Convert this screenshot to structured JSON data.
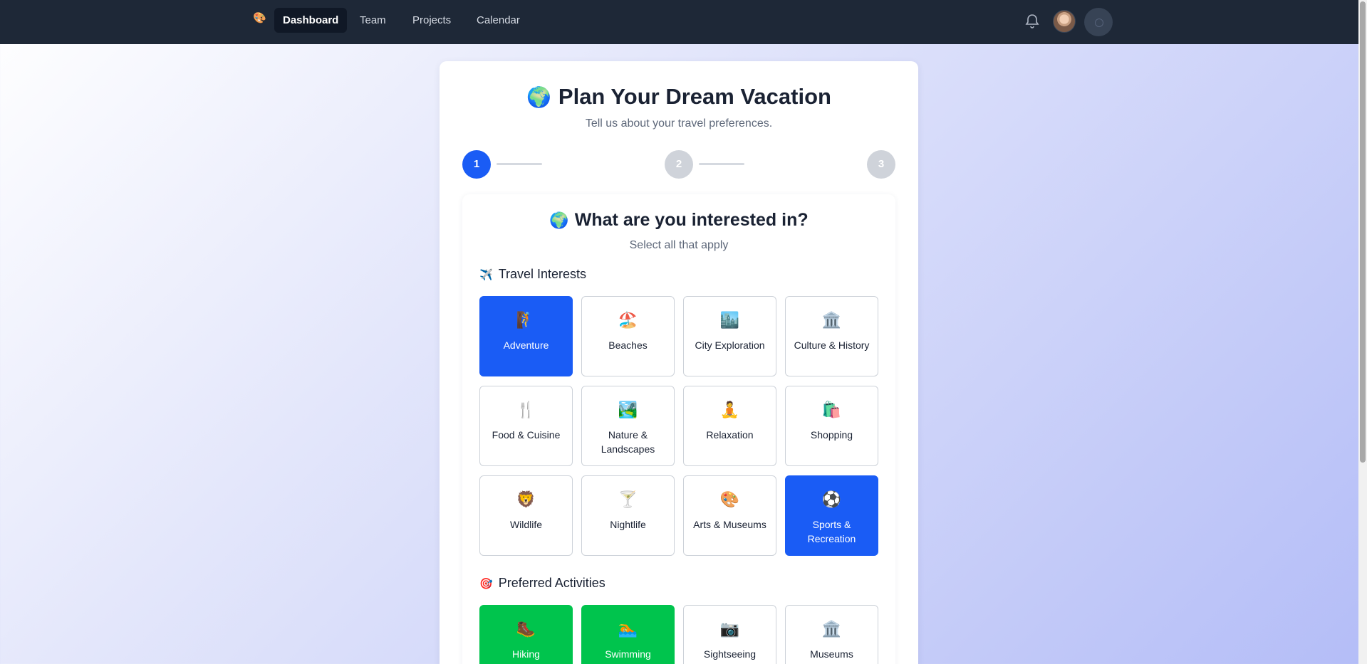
{
  "nav": {
    "logo_glyph": "🎨",
    "links": [
      {
        "label": "Dashboard",
        "active": true
      },
      {
        "label": "Team",
        "active": false
      },
      {
        "label": "Projects",
        "active": false
      },
      {
        "label": "Calendar",
        "active": false
      }
    ],
    "icons": [
      "bell-icon",
      "avatar",
      "loading-button"
    ]
  },
  "page": {
    "title_emoji": "🌍",
    "title": "Plan Your Dream Vacation",
    "subtitle": "Tell us about your travel preferences.",
    "steps": [
      "1",
      "2",
      "3"
    ],
    "active_step": 1
  },
  "question": {
    "emoji": "🌍",
    "title": "What are you interested in?",
    "subtitle": "Select all that apply"
  },
  "interests": {
    "emoji": "✈️",
    "title": "Travel Interests",
    "items": [
      {
        "icon": "🧗",
        "label": "Adventure",
        "selected": true
      },
      {
        "icon": "🏖️",
        "label": "Beaches",
        "selected": false
      },
      {
        "icon": "🏙️",
        "label": "City Exploration",
        "selected": false
      },
      {
        "icon": "🏛️",
        "label": "Culture & History",
        "selected": false
      },
      {
        "icon": "🍴",
        "label": "Food & Cuisine",
        "selected": false
      },
      {
        "icon": "🏞️",
        "label": "Nature & Landscapes",
        "selected": false
      },
      {
        "icon": "🧘",
        "label": "Relaxation",
        "selected": false
      },
      {
        "icon": "🛍️",
        "label": "Shopping",
        "selected": false
      },
      {
        "icon": "🦁",
        "label": "Wildlife",
        "selected": false
      },
      {
        "icon": "🍸",
        "label": "Nightlife",
        "selected": false
      },
      {
        "icon": "🎨",
        "label": "Arts & Museums",
        "selected": false
      },
      {
        "icon": "⚽",
        "label": "Sports & Recreation",
        "selected": true
      }
    ]
  },
  "activities": {
    "emoji": "🎯",
    "title": "Preferred Activities",
    "items": [
      {
        "icon": "🥾",
        "label": "Hiking",
        "selected": true
      },
      {
        "icon": "🏊",
        "label": "Swimming",
        "selected": true
      },
      {
        "icon": "📷",
        "label": "Sightseeing",
        "selected": false
      },
      {
        "icon": "🏛️",
        "label": "Museums",
        "selected": false
      }
    ]
  },
  "colors": {
    "nav_bg": "#1e2837",
    "primary": "#1a5cf5",
    "success": "#00c44d"
  }
}
